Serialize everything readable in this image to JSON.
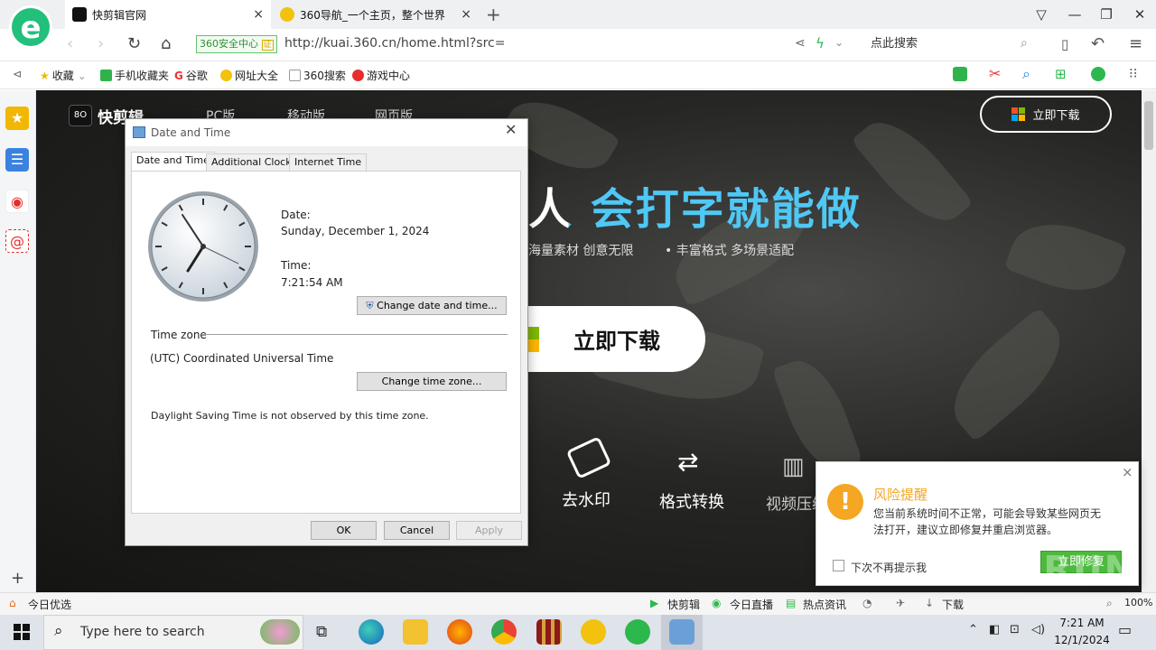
{
  "browser": {
    "tabs": [
      {
        "title": "快剪辑官网",
        "close": "×"
      },
      {
        "title": "360导航_一个主页，整个世界",
        "close": "×"
      }
    ],
    "new_tab": "+",
    "window_buttons": {
      "minimize": "—",
      "maximize": "❐",
      "close": "✕"
    },
    "safety_badge": "360安全中心",
    "url": "http://kuai.360.cn/home.html?src=",
    "search_placeholder": "点此搜索",
    "bookmarks": [
      "收藏",
      "手机收藏夹",
      "谷歌",
      "网址大全",
      "360搜索",
      "游戏中心"
    ]
  },
  "webpage": {
    "logo": "快剪辑",
    "nav": [
      "PC版",
      "移动版",
      "网页版"
    ],
    "download_top": "立即下载",
    "headline": "人 会打字就能做",
    "features_line": [
      "海量素材 创意无限",
      "丰富格式 多场景适配"
    ],
    "download_big": "立即下载",
    "feature_icons": [
      {
        "label": "去水印"
      },
      {
        "label": "格式转换"
      },
      {
        "label": "视频压缩"
      }
    ]
  },
  "dialog": {
    "title": "Date and Time",
    "close": "✕",
    "tabs": [
      "Date and Time",
      "Additional Clocks",
      "Internet Time"
    ],
    "date_label": "Date:",
    "date_value": "Sunday, December 1, 2024",
    "time_label": "Time:",
    "time_value": "7:21:54 AM",
    "change_datetime_button": "Change date and time...",
    "time_zone_heading": "Time zone",
    "time_zone_value": "(UTC) Coordinated Universal Time",
    "change_timezone_button": "Change time zone...",
    "dst_note": "Daylight Saving Time is not observed by this time zone.",
    "ok": "OK",
    "cancel": "Cancel",
    "apply": "Apply"
  },
  "notification": {
    "title": "风险提醒",
    "body": "您当前系统时间不正常，可能会导致某些网页无法打开，建议立即修复并重启浏览器。",
    "checkbox_label": "下次不再提示我",
    "fix_button": "立即修复",
    "close": "×"
  },
  "statusbar": {
    "left": "今日优选",
    "items": [
      "快剪辑",
      "今日直播",
      "热点资讯",
      "下载"
    ],
    "zoom": "100%"
  },
  "taskbar": {
    "search_placeholder": "Type here to search",
    "time": "7:21 AM",
    "date": "12/1/2024"
  },
  "watermark": "ANY RUN",
  "colors": {
    "accent_green": "#22c07a",
    "headline_blue": "#4fc8f5",
    "fix_green": "#4cba3c",
    "warning_orange": "#f5a623"
  }
}
